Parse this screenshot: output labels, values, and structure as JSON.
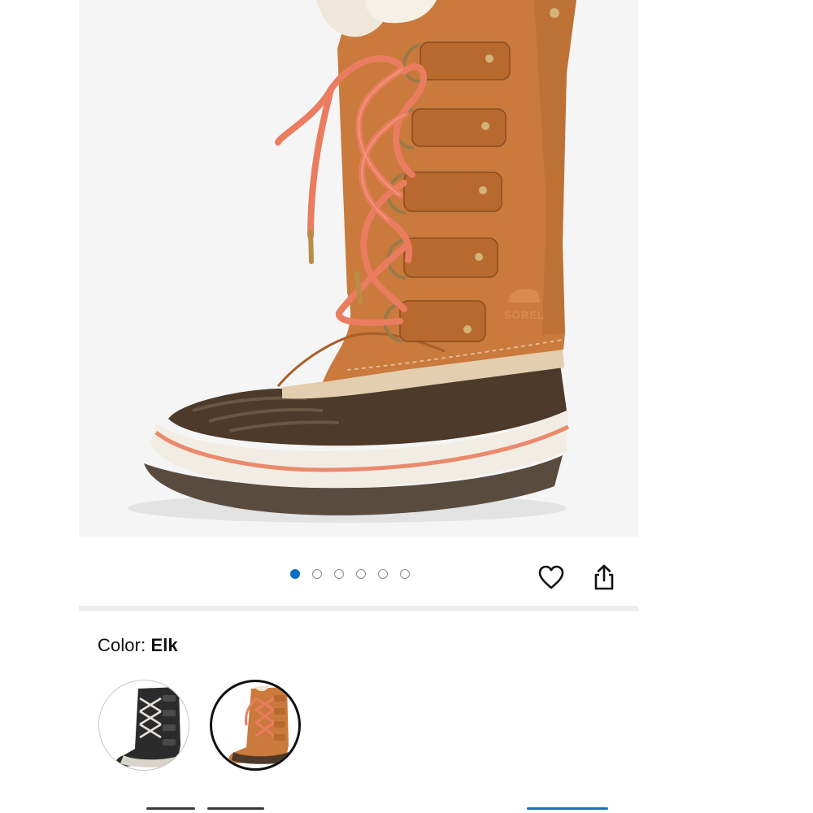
{
  "product": {
    "image_alt": "Sorel women's snow boot in Elk",
    "brand_mark": "SOREL"
  },
  "gallery": {
    "image_count": 6,
    "active_index": 0
  },
  "actions": {
    "favorite_icon": "heart-outline-icon",
    "share_icon": "share-icon"
  },
  "color_selector": {
    "label": "Color: ",
    "selected_value": "Elk",
    "swatches": [
      {
        "name": "Black",
        "selected": false
      },
      {
        "name": "Elk",
        "selected": true
      }
    ]
  },
  "colors": {
    "accent_blue": "#0a6fc2",
    "boot_tan": "#c9793c",
    "lace_coral": "#e97a5e",
    "rubber_brown": "#4a3a2c"
  }
}
